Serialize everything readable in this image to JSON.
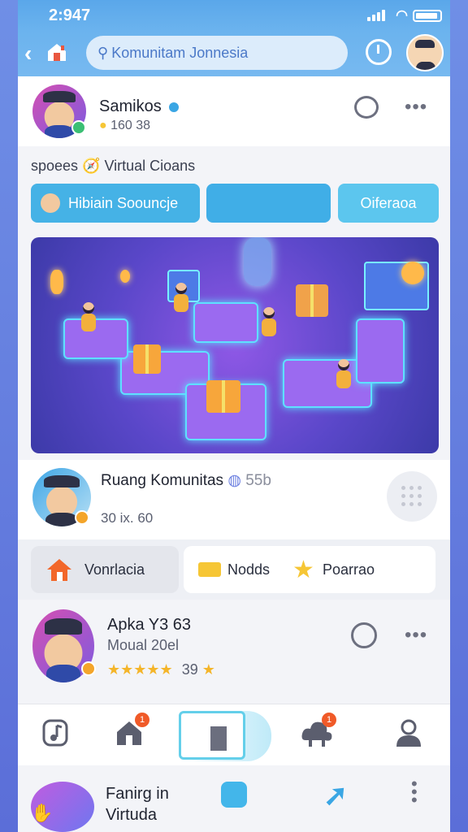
{
  "status": {
    "time": "2:947"
  },
  "topbar": {
    "search_text": "Komunitam Jonnesia"
  },
  "profile": {
    "name": "Samikos",
    "stats": "160 38"
  },
  "tagline": "spoees 🧭 Virtual Cioans",
  "tabs": [
    {
      "label": "Hibiain Soouncje"
    },
    {
      "label": ""
    },
    {
      "label": "Oiferaoa"
    }
  ],
  "community": {
    "title": "Ruang Komunitas",
    "count": "55b",
    "stats": "30 ix. 60"
  },
  "pills": [
    {
      "label": "Vonrlacia"
    },
    {
      "label": "Nodds"
    },
    {
      "label": "Poarrao"
    }
  ],
  "app": {
    "name": "Apka Y3 63",
    "subtitle": "Moual 20el",
    "rating_count": "39"
  },
  "bottom_card": {
    "title_line1": "Fanirg in",
    "title_line2": "Virtuda"
  },
  "colors": {
    "accent": "#45b2e6",
    "header": "#6bb3ee",
    "star": "#f6c635",
    "notification": "#f05a28"
  }
}
